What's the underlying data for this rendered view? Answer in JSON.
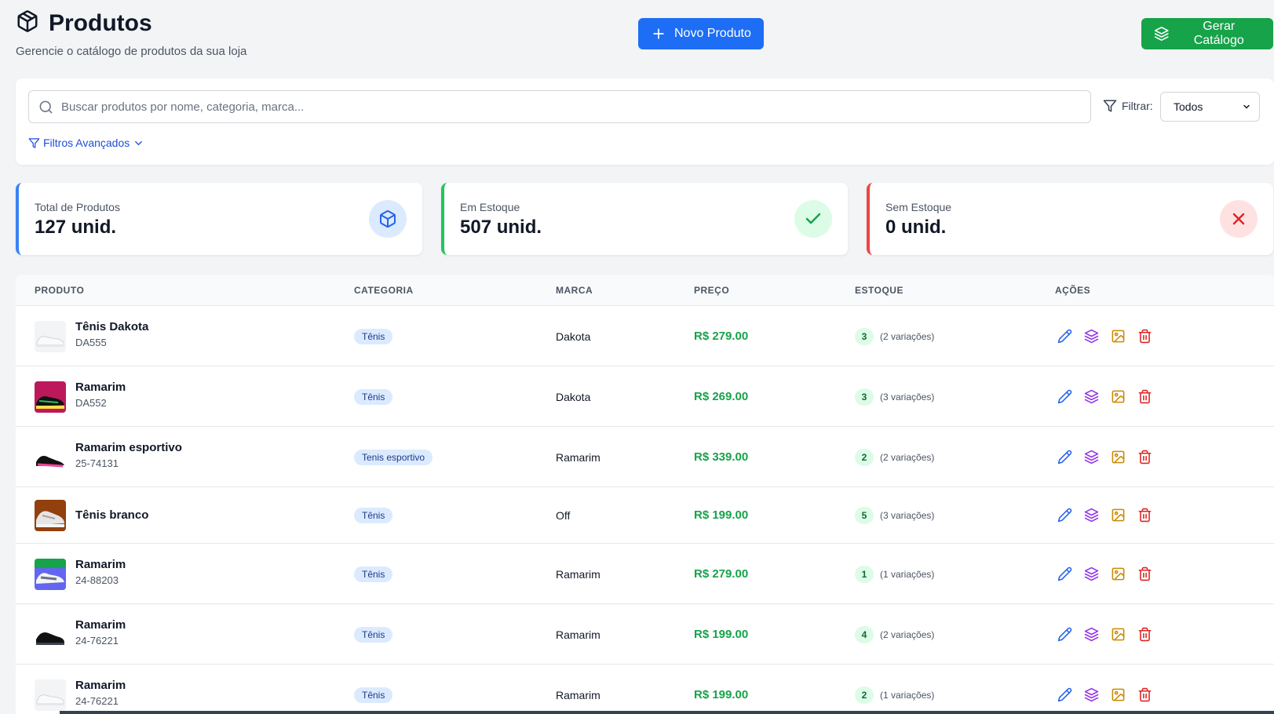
{
  "header": {
    "title": "Produtos",
    "subtitle": "Gerencie o catálogo de produtos da sua loja",
    "new_product_label": "Novo Produto",
    "catalog_label": "Gerar Catálogo"
  },
  "search": {
    "placeholder": "Buscar produtos por nome, categoria, marca...",
    "filter_label": "Filtrar:",
    "filter_value": "Todos",
    "advanced_label": "Filtros Avançados"
  },
  "stats": [
    {
      "label": "Total de Produtos",
      "value": "127 unid.",
      "color": "#3b82f6"
    },
    {
      "label": "Em Estoque",
      "value": "507 unid.",
      "color": "#22c55e"
    },
    {
      "label": "Sem Estoque",
      "value": "0 unid.",
      "color": "#ef4444"
    }
  ],
  "table": {
    "columns": [
      "PRODUTO",
      "CATEGORIA",
      "MARCA",
      "PREÇO",
      "ESTOQUE",
      "AÇÕES"
    ],
    "rows": [
      {
        "name": "Tênis Dakota",
        "sku": "DA555",
        "category": "Tênis",
        "brand": "Dakota",
        "price": "R$ 279.00",
        "stock": "3",
        "variations": "(2 variações)",
        "thumb": "white-sneaker"
      },
      {
        "name": "Ramarim",
        "sku": "DA552",
        "category": "Tênis",
        "brand": "Dakota",
        "price": "R$ 269.00",
        "stock": "3",
        "variations": "(3 variações)",
        "thumb": "pink-sneaker"
      },
      {
        "name": "Ramarim esportivo",
        "sku": "25-74131",
        "category": "Tenis esportivo",
        "brand": "Ramarim",
        "price": "R$ 339.00",
        "stock": "2",
        "variations": "(2 variações)",
        "thumb": "black-pink-sneaker"
      },
      {
        "name": "Tênis branco",
        "sku": "",
        "category": "Tênis",
        "brand": "Off",
        "price": "R$ 199.00",
        "stock": "5",
        "variations": "(3 variações)",
        "thumb": "beige-sneaker"
      },
      {
        "name": "Ramarim",
        "sku": "24-88203",
        "category": "Tênis",
        "brand": "Ramarim",
        "price": "R$ 279.00",
        "stock": "1",
        "variations": "(1 variações)",
        "thumb": "multi-sneaker"
      },
      {
        "name": "Ramarim",
        "sku": "24-76221",
        "category": "Tênis",
        "brand": "Ramarim",
        "price": "R$ 199.00",
        "stock": "4",
        "variations": "(2 variações)",
        "thumb": "black-sneaker"
      },
      {
        "name": "Ramarim",
        "sku": "24-76221",
        "category": "Tênis",
        "brand": "Ramarim",
        "price": "R$ 199.00",
        "stock": "2",
        "variations": "(1 variações)",
        "thumb": "white-sneaker"
      }
    ]
  },
  "colors": {
    "primary": "#1d6ef5",
    "success": "#16a34a",
    "edit": "#2563eb",
    "variations": "#9333ea",
    "image": "#ca8a04",
    "delete": "#dc2626"
  }
}
